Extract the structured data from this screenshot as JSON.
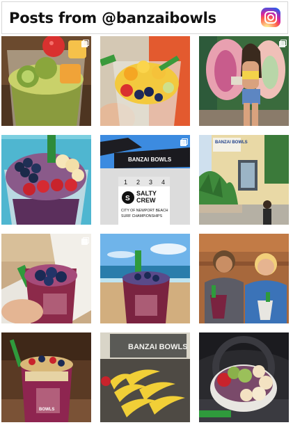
{
  "header": {
    "title": "Posts from @banzaibowls",
    "icon": "instagram-icon"
  },
  "sign": {
    "brand_top": "BANZAI BOWLS",
    "storefront": "BANZAI BOWLS",
    "salty": "SALTY",
    "crew": "CREW",
    "event_line1": "CITY OF NEWPORT BEACH",
    "event_line2": "SURF CHAMPIONSHIPS",
    "numbers": [
      "1",
      "2",
      "3",
      "4"
    ],
    "cup_brand_1": "BANZAI",
    "cup_brand_2": "BOWLS",
    "banner": "BANZAI BOWLS"
  },
  "posts": [
    {
      "name": "acai-cup-kiwi-mango",
      "multi": true
    },
    {
      "name": "fruit-cup-in-hand",
      "multi": false
    },
    {
      "name": "woman-with-bowl-wings-mural",
      "multi": true
    },
    {
      "name": "acai-bowl-berries-banana",
      "multi": false
    },
    {
      "name": "salty-crew-surf-championship-sign",
      "multi": true
    },
    {
      "name": "banzai-bowls-storefront",
      "multi": false
    },
    {
      "name": "acai-cup-held-in-hand",
      "multi": true
    },
    {
      "name": "acai-cup-on-beach",
      "multi": false
    },
    {
      "name": "two-boys-with-acai-cups",
      "multi": false
    },
    {
      "name": "acai-cup-granola-on-table",
      "multi": false
    },
    {
      "name": "banana-display-under-banner",
      "multi": false
    },
    {
      "name": "acai-bowl-in-car",
      "multi": false
    }
  ],
  "colors": {
    "border": "#d6d6d6",
    "title_text": "#111111"
  }
}
